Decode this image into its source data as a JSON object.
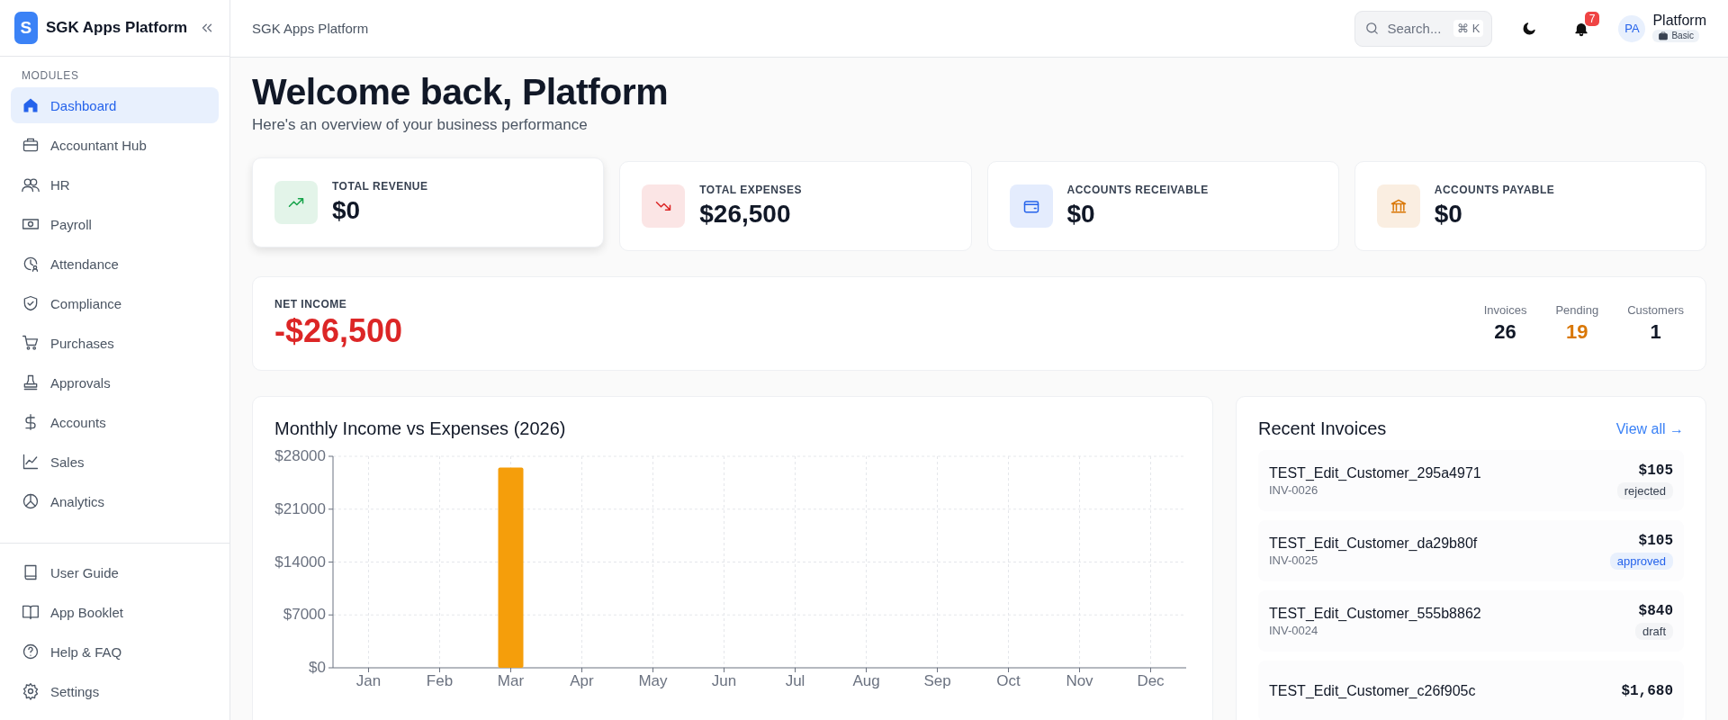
{
  "app": {
    "logo_letter": "S",
    "name": "SGK Apps Platform"
  },
  "sidebar": {
    "section_label": "MODULES",
    "items": [
      {
        "label": "Dashboard",
        "kind": "home",
        "selected": true
      },
      {
        "label": "Accountant Hub",
        "kind": "briefcase",
        "selected": false
      },
      {
        "label": "HR",
        "kind": "users",
        "selected": false
      },
      {
        "label": "Payroll",
        "kind": "money",
        "selected": false
      },
      {
        "label": "Attendance",
        "kind": "clock",
        "selected": false
      },
      {
        "label": "Compliance",
        "kind": "shield",
        "selected": false
      },
      {
        "label": "Purchases",
        "kind": "cart",
        "selected": false
      },
      {
        "label": "Approvals",
        "kind": "stamp",
        "selected": false
      },
      {
        "label": "Accounts",
        "kind": "dollar",
        "selected": false
      },
      {
        "label": "Sales",
        "kind": "chart",
        "selected": false
      },
      {
        "label": "Analytics",
        "kind": "pie",
        "selected": false
      }
    ],
    "footer_items": [
      {
        "label": "User Guide",
        "kind": "book"
      },
      {
        "label": "App Booklet",
        "kind": "open-book"
      },
      {
        "label": "Help & FAQ",
        "kind": "help"
      },
      {
        "label": "Settings",
        "kind": "gear"
      }
    ]
  },
  "header": {
    "breadcrumb": "SGK Apps Platform",
    "search": {
      "placeholder": "Search...",
      "shortcut": "⌘ K"
    },
    "notifications_count": "7",
    "user": {
      "initials": "PA",
      "name": "Platform",
      "plan": "Basic"
    }
  },
  "page": {
    "title": "Welcome back, Platform",
    "subtitle": "Here's an overview of your business performance"
  },
  "stat_cards": [
    {
      "label": "TOTAL REVENUE",
      "value": "$0",
      "kind": "trend-up",
      "color": "#16a34a",
      "hovered": true
    },
    {
      "label": "TOTAL EXPENSES",
      "value": "$26,500",
      "kind": "trend-down",
      "color": "#dc2626",
      "hovered": false
    },
    {
      "label": "ACCOUNTS RECEIVABLE",
      "value": "$0",
      "kind": "wallet",
      "color": "#2563eb",
      "hovered": false
    },
    {
      "label": "ACCOUNTS PAYABLE",
      "value": "$0",
      "kind": "bank",
      "color": "#d97706",
      "hovered": false
    }
  ],
  "net_income": {
    "label": "NET INCOME",
    "value": "-$26,500",
    "stats": [
      {
        "label": "Invoices",
        "value": "26",
        "color": "#111827"
      },
      {
        "label": "Pending",
        "value": "19",
        "color": "#d97706"
      },
      {
        "label": "Customers",
        "value": "1",
        "color": "#111827"
      }
    ]
  },
  "chart_panel": {
    "title": "Monthly Income vs Expenses (2026)",
    "chart_data": {
      "type": "bar",
      "grid": true,
      "categories": [
        "Jan",
        "Feb",
        "Mar",
        "Apr",
        "May",
        "Jun",
        "Jul",
        "Aug",
        "Sep",
        "Oct",
        "Nov",
        "Dec"
      ],
      "values": [
        0,
        0,
        26500,
        0,
        0,
        0,
        0,
        0,
        0,
        0,
        0,
        0
      ],
      "ylim": [
        0,
        28000
      ],
      "yticks": [
        {
          "value": 0,
          "label": "$0"
        },
        {
          "value": 7000,
          "label": "$7000"
        },
        {
          "value": 14000,
          "label": "$14000"
        },
        {
          "value": 21000,
          "label": "$21000"
        },
        {
          "value": 28000,
          "label": "$28000"
        }
      ]
    }
  },
  "recent_invoices": {
    "title": "Recent Invoices",
    "view_all": "View all →",
    "rows": [
      {
        "customer": "TEST_Edit_Customer_295a4971",
        "number": "INV-0026",
        "amount": "$105",
        "status": "rejected"
      },
      {
        "customer": "TEST_Edit_Customer_da29b80f",
        "number": "INV-0025",
        "amount": "$105",
        "status": "approved"
      },
      {
        "customer": "TEST_Edit_Customer_555b8862",
        "number": "INV-0024",
        "amount": "$840",
        "status": "draft"
      },
      {
        "customer": "TEST_Edit_Customer_c26f905c",
        "amount": "$1,680"
      }
    ]
  }
}
